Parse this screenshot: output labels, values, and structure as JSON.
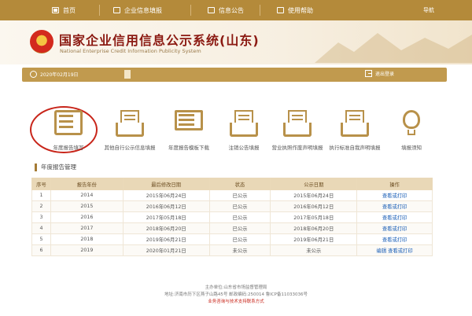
{
  "nav": {
    "home": "首页",
    "report": "企业信息填报",
    "notice": "信息公告",
    "help": "使用帮助",
    "guide": "导航"
  },
  "header": {
    "title": "国家企业信用信息公示系统(山东)",
    "subtitle": "National Enterprise Credit Information Publicity System"
  },
  "userbar": {
    "date": "2020年02月19日",
    "logout": "退出登录"
  },
  "functions": [
    {
      "label": "年度报告填写",
      "icon": "pencil-icon"
    },
    {
      "label": "其他自行公示信息填报",
      "icon": "inbox-icon"
    },
    {
      "label": "年度报告模板下载",
      "icon": "template-icon"
    },
    {
      "label": "注销公告填报",
      "icon": "inbox-icon"
    },
    {
      "label": "营业执照作废声明填报",
      "icon": "inbox-icon"
    },
    {
      "label": "执行标准自我声明填报",
      "icon": "inbox-icon"
    },
    {
      "label": "填报须知",
      "icon": "lightbulb-icon"
    }
  ],
  "section": {
    "title": "年度报告管理"
  },
  "table": {
    "headers": [
      "序号",
      "报告年份",
      "最后修改日期",
      "状态",
      "公示日期",
      "操作"
    ],
    "rows": [
      [
        "1",
        "2014",
        "2015年06月24日",
        "已公示",
        "2015年06月24日",
        "查看或打印"
      ],
      [
        "2",
        "2015",
        "2016年06月12日",
        "已公示",
        "2016年06月12日",
        "查看或打印"
      ],
      [
        "3",
        "2016",
        "2017年05月18日",
        "已公示",
        "2017年05月18日",
        "查看或打印"
      ],
      [
        "4",
        "2017",
        "2018年06月20日",
        "已公示",
        "2018年06月20日",
        "查看或打印"
      ],
      [
        "5",
        "2018",
        "2019年06月21日",
        "已公示",
        "2019年06月21日",
        "查看或打印"
      ],
      [
        "6",
        "2019",
        "2020年01月21日",
        "未公示",
        "未公示",
        "编辑  查看或打印"
      ]
    ]
  },
  "footer": {
    "line1": "主办单位:山东省市场监督管理局",
    "line2": "地址:济南市历下区燕子山路45号    邮政编码:250014    鲁ICP备11033036号",
    "line3": "业务咨询与技术支持联系方式"
  },
  "colors": {
    "nav_bg": "#b48a3a",
    "accent": "#c19a4e",
    "title_red": "#8b1a12",
    "link_blue": "#1b5fb7",
    "highlight_red": "#c8251a"
  }
}
